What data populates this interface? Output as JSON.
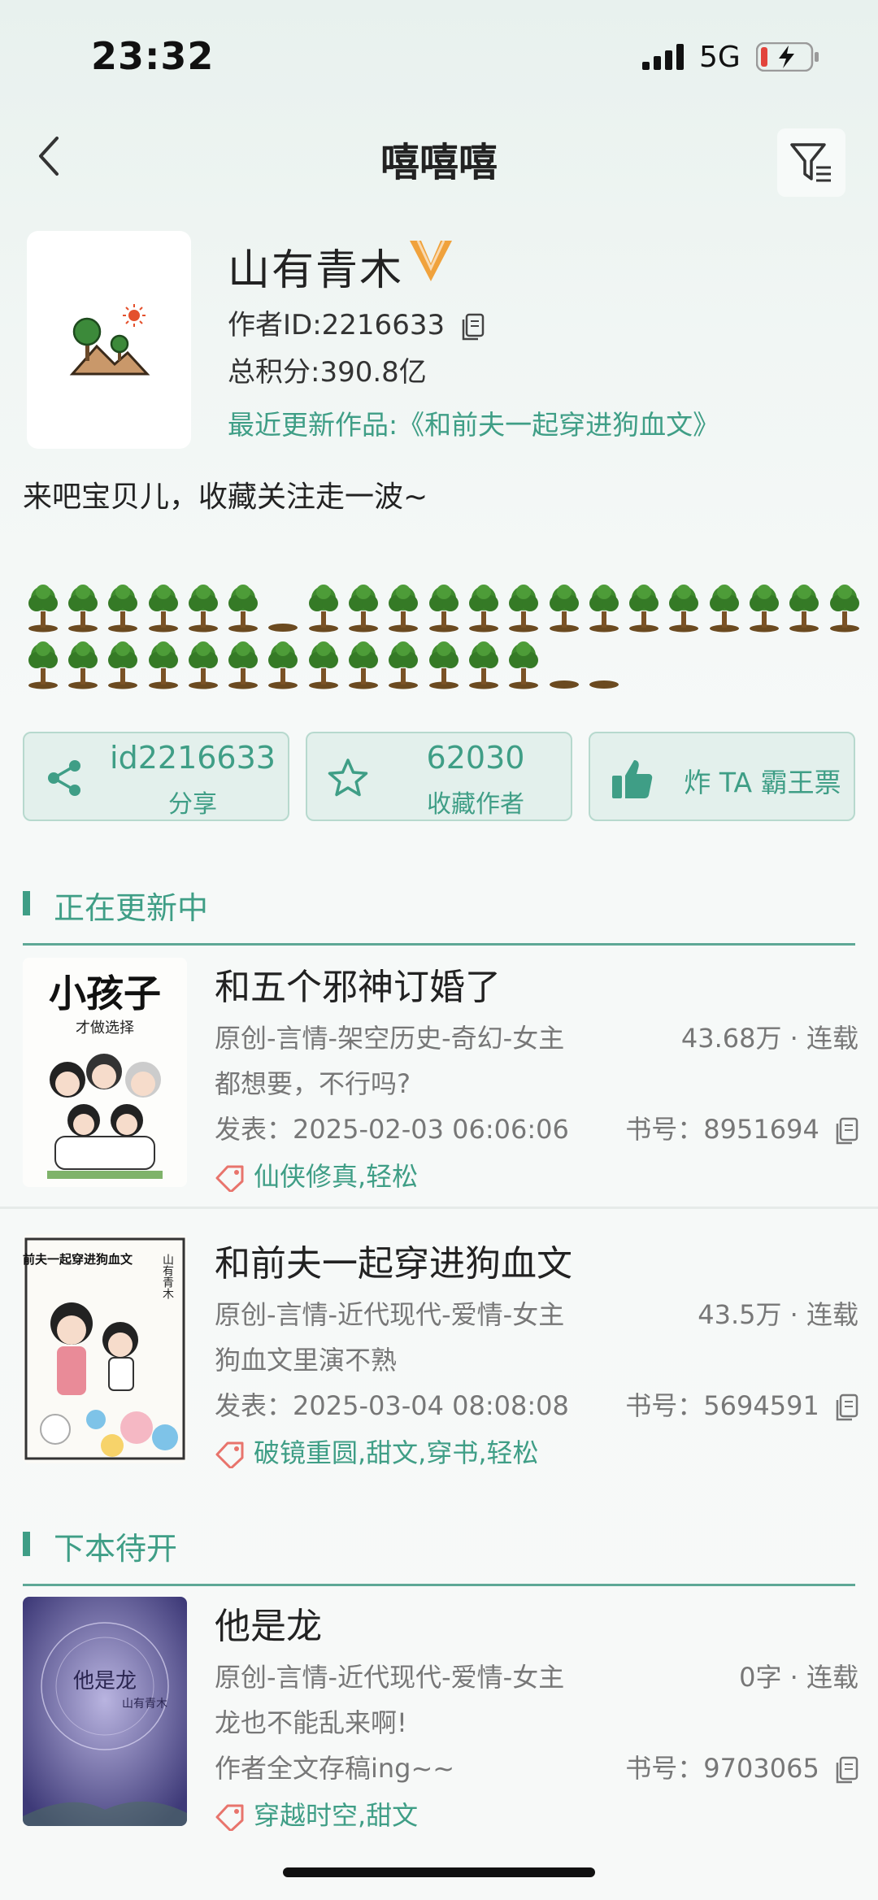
{
  "status": {
    "time": "23:32",
    "network": "5G"
  },
  "nav": {
    "title": "嘻嘻嘻"
  },
  "author": {
    "name": "山有青木",
    "id": "作者ID:2216633",
    "points": "总积分:390.8亿",
    "recent": "最近更新作品:《和前夫一起穿进狗血文》",
    "bio": "来吧宝贝儿，收藏关注走一波~"
  },
  "trees": {
    "row1": [
      "tree",
      "tree",
      "tree",
      "tree",
      "tree",
      "tree",
      "pit",
      "tree",
      "tree",
      "tree",
      "tree",
      "tree",
      "tree",
      "tree",
      "tree",
      "tree",
      "tree",
      "tree",
      "tree",
      "tree",
      "tree"
    ],
    "row2": [
      "tree",
      "tree",
      "tree",
      "tree",
      "tree",
      "tree",
      "tree",
      "tree",
      "tree",
      "tree",
      "tree",
      "tree",
      "tree",
      "pit",
      "pit"
    ]
  },
  "actions": {
    "share_num": "id2216633",
    "share_label": "分享",
    "fav_num": "62030",
    "fav_label": "收藏作者",
    "vote_label": "炸 TA 霸王票"
  },
  "sections": {
    "updating": "正在更新中",
    "upcoming": "下本待开"
  },
  "books": [
    {
      "title": "和五个邪神订婚了",
      "category": "原创-言情-架空历史-奇幻-女主",
      "stats": "43.68万 · 连载",
      "desc": "都想要，不行吗?",
      "date": "发表：2025-02-03 06:06:06",
      "book_id": "书号：8951694",
      "tags": "仙侠修真,轻松",
      "cover_text": "小孩子",
      "cover_sub": "才做选择"
    },
    {
      "title": "和前夫一起穿进狗血文",
      "category": "原创-言情-近代现代-爱情-女主",
      "stats": "43.5万 · 连载",
      "desc": "狗血文里演不熟",
      "date": "发表：2025-03-04 08:08:08",
      "book_id": "书号：5694591",
      "tags": "破镜重圆,甜文,穿书,轻松",
      "cover_text": "和前夫一起穿进狗血文",
      "cover_sub": "山有青木"
    },
    {
      "title": "他是龙",
      "category": "原创-言情-近代现代-爱情-女主",
      "stats": "0字 · 连载",
      "desc": "龙也不能乱来啊!",
      "date": "作者全文存稿ing~~",
      "book_id": "书号：9703065",
      "tags": "穿越时空,甜文",
      "cover_text": "他是龙",
      "cover_sub": "山有青木"
    }
  ],
  "colors": {
    "accent": "#3f9e86",
    "vip": "#f0a23c",
    "tag_icon": "#e8746c"
  }
}
